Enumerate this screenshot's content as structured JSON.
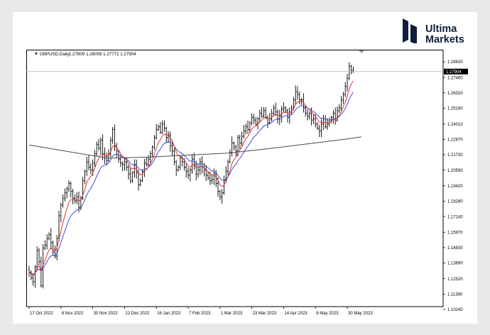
{
  "brand": {
    "line1": "Ultima",
    "line2": "Markets",
    "text_color": "#0f1e3c",
    "icon": "ultima-markets-logo-icon"
  },
  "chart_header": {
    "symbol_timeframe": "GBPUSD,Daily",
    "ohlc": "1.27809 1.28059 1.27772 1.27904"
  },
  "chart_data": {
    "type": "line",
    "title": "GBPUSD,Daily",
    "y_axis": {
      "min": 1.1024,
      "max": 1.2863,
      "ticks": [
        "1.28630",
        "1.27460",
        "1.26320",
        "1.25180",
        "1.24010",
        "1.22870",
        "1.21730",
        "1.20590",
        "1.19420",
        "1.18280",
        "1.17140",
        "1.15970",
        "1.14830",
        "1.13690",
        "1.12520",
        "1.11380",
        "1.10240"
      ],
      "position": "right"
    },
    "x_axis": {
      "ticks": [
        "17 Oct 2022",
        "8 Nov 2022",
        "30 Nov 2022",
        "22 Dec 2022",
        "16 Jan 2023",
        "7 Feb 2023",
        "1 Mar 2023",
        "23 Mar 2023",
        "14 Apr 2023",
        "8 May 2023",
        "30 May 2023"
      ],
      "tick_bar_index": [
        0,
        16,
        32,
        48,
        64,
        80,
        96,
        112,
        128,
        144,
        160
      ]
    },
    "current_price": {
      "value": 1.27904,
      "label": "1.27904"
    },
    "grid": false,
    "series": [
      {
        "kind": "price",
        "color": "#000000",
        "values": [
          1.13,
          1.126,
          1.123,
          1.134,
          1.146,
          1.138,
          1.12,
          1.148,
          1.15,
          1.155,
          1.158,
          1.152,
          1.145,
          1.142,
          1.155,
          1.172,
          1.18,
          1.185,
          1.189,
          1.192,
          1.196,
          1.19,
          1.185,
          1.183,
          1.186,
          1.178,
          1.185,
          1.198,
          1.205,
          1.212,
          1.208,
          1.206,
          1.211,
          1.218,
          1.225,
          1.222,
          1.228,
          1.218,
          1.215,
          1.213,
          1.218,
          1.228,
          1.236,
          1.224,
          1.22,
          1.214,
          1.211,
          1.21,
          1.212,
          1.208,
          1.203,
          1.198,
          1.204,
          1.21,
          1.204,
          1.195,
          1.198,
          1.205,
          1.211,
          1.21,
          1.214,
          1.218,
          1.223,
          1.23,
          1.236,
          1.238,
          1.234,
          1.24,
          1.237,
          1.23,
          1.232,
          1.224,
          1.22,
          1.212,
          1.206,
          1.208,
          1.215,
          1.212,
          1.208,
          1.205,
          1.202,
          1.206,
          1.214,
          1.21,
          1.203,
          1.206,
          1.212,
          1.208,
          1.206,
          1.202,
          1.2,
          1.198,
          1.199,
          1.203,
          1.196,
          1.19,
          1.186,
          1.189,
          1.198,
          1.205,
          1.212,
          1.219,
          1.226,
          1.223,
          1.22,
          1.23,
          1.226,
          1.231,
          1.235,
          1.238,
          1.236,
          1.241,
          1.245,
          1.243,
          1.24,
          1.244,
          1.248,
          1.246,
          1.25,
          1.245,
          1.241,
          1.244,
          1.248,
          1.252,
          1.249,
          1.244,
          1.246,
          1.251,
          1.252,
          1.25,
          1.245,
          1.249,
          1.252,
          1.258,
          1.264,
          1.262,
          1.258,
          1.258,
          1.252,
          1.248,
          1.246,
          1.248,
          1.243,
          1.244,
          1.24,
          1.237,
          1.235,
          1.24,
          1.244,
          1.238,
          1.24,
          1.243,
          1.245,
          1.248,
          1.243,
          1.25,
          1.252,
          1.258,
          1.262,
          1.268,
          1.274,
          1.283,
          1.28,
          1.279
        ]
      },
      {
        "kind": "ma_blue",
        "color": "#3b4fd6"
      },
      {
        "kind": "ma_red",
        "color": "#e0342e"
      },
      {
        "kind": "ma_long",
        "color": "#4a4a4a",
        "anchors": [
          [
            0,
            1.2245
          ],
          [
            20,
            1.2195
          ],
          [
            40,
            1.2147
          ],
          [
            60,
            1.2155
          ],
          [
            80,
            1.217
          ],
          [
            100,
            1.2185
          ],
          [
            120,
            1.2217
          ],
          [
            140,
            1.2253
          ],
          [
            160,
            1.229
          ],
          [
            167,
            1.2305
          ]
        ]
      }
    ]
  }
}
